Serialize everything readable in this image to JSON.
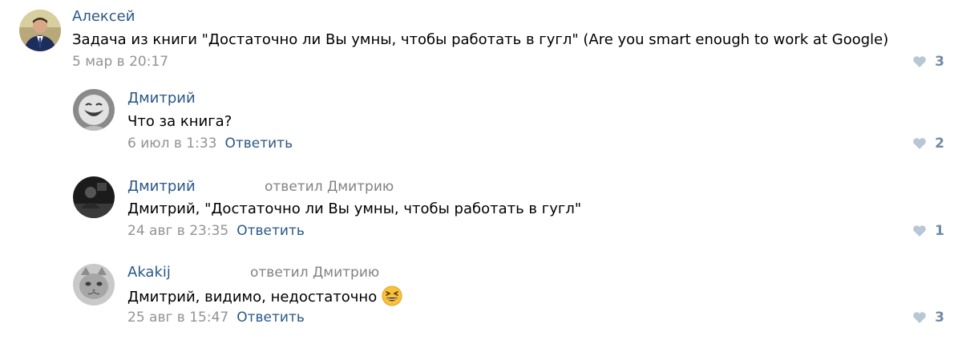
{
  "comments": [
    {
      "author": "Алексей",
      "reply_to": "",
      "text": "Задача из книги \"Достаточно ли Вы умны, чтобы работать в гугл\" (Are you smart enough to work at Google)",
      "date": "5 мар в 20:17",
      "reply_label": "",
      "likes": "3",
      "avatar": "man-in-suit-avatar"
    },
    {
      "author": "Дмитрий",
      "reply_to": "",
      "text": "Что за книга?",
      "date": "6 июл в 1:33",
      "reply_label": "Ответить",
      "likes": "2",
      "avatar": "laughing-baby-avatar"
    },
    {
      "author": "Дмитрий",
      "reply_to": "ответил Дмитрию",
      "text": "Дмитрий, \"Достаточно ли Вы умны, чтобы работать в гугл\"",
      "date": "24 авг в 23:35",
      "reply_label": "Ответить",
      "likes": "1",
      "avatar": "dark-photo-avatar"
    },
    {
      "author": "Akakij",
      "reply_to": "ответил Дмитрию",
      "text": "Дмитрий, видимо, недостаточно",
      "emoji": "laughing-face-emoji",
      "date": "25 авг в 15:47",
      "reply_label": "Ответить",
      "likes": "3",
      "avatar": "cat-avatar"
    }
  ],
  "colors": {
    "author": "#2a5885",
    "date": "#939393",
    "likes": "#6f8aa6",
    "heart": "#b8c7d6"
  }
}
